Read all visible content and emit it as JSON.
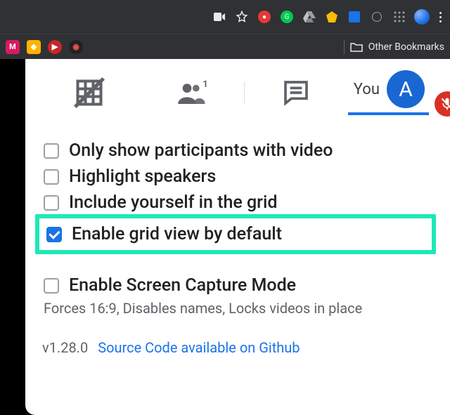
{
  "browser": {
    "other_bookmarks": "Other Bookmarks"
  },
  "tabs": {
    "you_label": "You",
    "avatar_letter": "A"
  },
  "options": [
    {
      "label": "Only show participants with video",
      "checked": false
    },
    {
      "label": "Highlight speakers",
      "checked": false
    },
    {
      "label": "Include yourself in the grid",
      "checked": false
    },
    {
      "label": "Enable grid view by default",
      "checked": true,
      "highlighted": true
    },
    {
      "label": "Enable Screen Capture Mode",
      "checked": false,
      "desc": "Forces 16:9, Disables names, Locks videos in place"
    }
  ],
  "footer": {
    "version": "v1.28.0",
    "link": "Source Code available on Github"
  }
}
